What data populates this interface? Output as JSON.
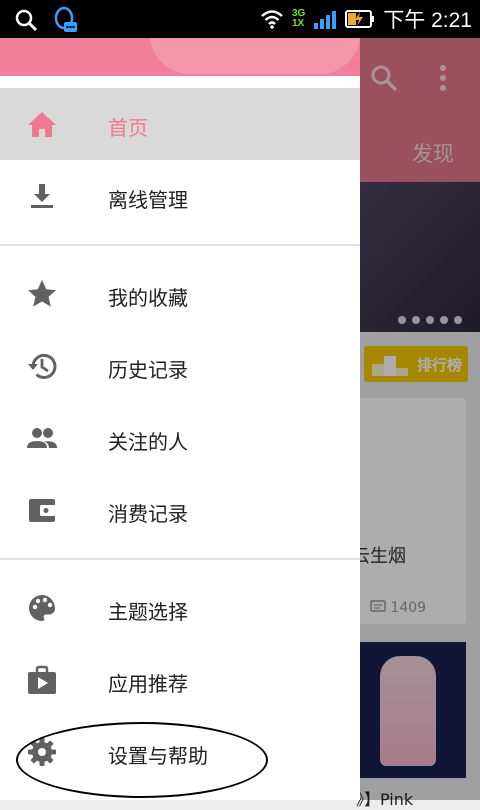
{
  "status_bar": {
    "time": "下午 2:21",
    "network_top": "3G",
    "network_bottom": "1X",
    "icons": [
      "search-icon",
      "qq-notification-icon",
      "wifi-icon",
      "signal-icon",
      "battery-charging-icon"
    ]
  },
  "background_app": {
    "tab_label": "发现",
    "ranking_label": "排行榜",
    "card_title": "云生烟",
    "card_count": "1409",
    "card2_title": "》】Pink",
    "colors": {
      "toolbar": "#e5778e",
      "badge": "#f5c800"
    }
  },
  "drawer": {
    "header_color": "#f27f9c",
    "accent_color": "#f07891",
    "items": [
      {
        "label": "首页",
        "icon": "home-icon",
        "selected": true
      },
      {
        "label": "离线管理",
        "icon": "download-icon",
        "selected": false
      },
      {
        "label": "我的收藏",
        "icon": "star-icon",
        "selected": false
      },
      {
        "label": "历史记录",
        "icon": "history-icon",
        "selected": false
      },
      {
        "label": "关注的人",
        "icon": "people-icon",
        "selected": false
      },
      {
        "label": "消费记录",
        "icon": "wallet-icon",
        "selected": false
      },
      {
        "label": "主题选择",
        "icon": "palette-icon",
        "selected": false
      },
      {
        "label": "应用推荐",
        "icon": "app-store-play-icon",
        "selected": false
      },
      {
        "label": "设置与帮助",
        "icon": "gear-icon",
        "selected": false
      }
    ]
  }
}
